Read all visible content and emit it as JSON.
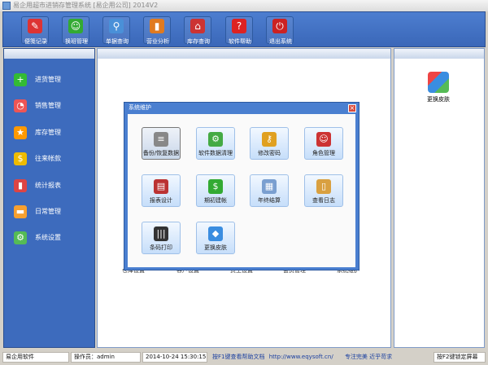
{
  "window": {
    "title": "易企用超市进销存管理系统 [易企用公司] 2014V2"
  },
  "toolbar": [
    {
      "label": "便笺记录",
      "icon": "notepad-icon",
      "color": "#d33"
    },
    {
      "label": "换班管理",
      "icon": "users-icon",
      "color": "#3a3"
    },
    {
      "label": "单据查询",
      "icon": "magnifier-icon",
      "color": "#4a90d8"
    },
    {
      "label": "营业分析",
      "icon": "bar-chart-icon",
      "color": "#e07a20"
    },
    {
      "label": "库存查询",
      "icon": "house-icon",
      "color": "#c33"
    },
    {
      "label": "软件帮助",
      "icon": "help-icon",
      "color": "#d22"
    },
    {
      "label": "退出系统",
      "icon": "power-icon",
      "color": "#c22"
    }
  ],
  "sidebar": [
    {
      "label": "进货管理",
      "icon": "plus-icon",
      "color": "#3b3"
    },
    {
      "label": "销售管理",
      "icon": "pie-chart-icon",
      "color": "#e55"
    },
    {
      "label": "库存管理",
      "icon": "star-icon",
      "color": "#f90"
    },
    {
      "label": "往来帐款",
      "icon": "dollar-icon",
      "color": "#eb0"
    },
    {
      "label": "统计报表",
      "icon": "bar-chart-icon",
      "color": "#d44"
    },
    {
      "label": "日常管理",
      "icon": "folder-icon",
      "color": "#f7a030"
    },
    {
      "label": "系统设置",
      "icon": "gear-icon",
      "color": "#5b5"
    }
  ],
  "background_labels": [
    "仓库设置",
    "客户设置",
    "员工设置",
    "会员管理",
    "系统维护"
  ],
  "right_panel": {
    "label": "更换皮肤"
  },
  "dialog": {
    "title": "系统维护",
    "buttons": [
      {
        "label": "备份/恢复数据",
        "icon": "database-icon",
        "color": "#888"
      },
      {
        "label": "软件数据清理",
        "icon": "gear-icon",
        "color": "#4a4"
      },
      {
        "label": "修改密码",
        "icon": "key-icon",
        "color": "#e0a020"
      },
      {
        "label": "角色管理",
        "icon": "users-icon",
        "color": "#c33"
      },
      {
        "label": "报表设计",
        "icon": "report-icon",
        "color": "#b33"
      },
      {
        "label": "期初建帐",
        "icon": "dollar-icon",
        "color": "#3a3"
      },
      {
        "label": "年终结算",
        "icon": "calendar-icon",
        "color": "#7a9fd0"
      },
      {
        "label": "查看日志",
        "icon": "clipboard-icon",
        "color": "#d9a040"
      },
      {
        "label": "条码打印",
        "icon": "barcode-icon",
        "color": "#333"
      },
      {
        "label": "更换皮肤",
        "icon": "cubes-icon",
        "color": "#3a8de0"
      }
    ]
  },
  "status": {
    "company": "易企用软件",
    "operator": "操作员：admin",
    "datetime": "2014-10-24 15:30:15",
    "help": "按F1键查看帮助文档",
    "url": "http://www.eqysoft.cn/",
    "slogan": "专注完美 近乎苛求",
    "lock": "按F2键锁定屏幕"
  }
}
